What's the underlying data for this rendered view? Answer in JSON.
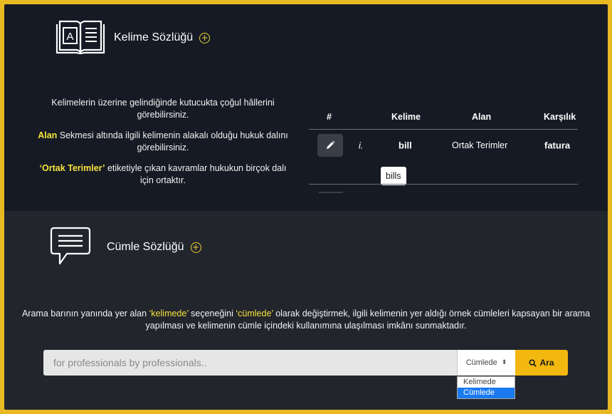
{
  "word_section": {
    "title": "Kelime Sözlüğü",
    "book_letter": "A",
    "info": {
      "p1": "Kelimelerin üzerine gelindiğinde kutucukta çoğul hâllerini görebilirsiniz.",
      "p2_highlight": "Alan",
      "p2_rest": " Sekmesi altında ilgili kelimenin alakalı olduğu hukuk dalını görebilirsiniz.",
      "p3_highlight": "‘Ortak Terimler’",
      "p3_rest": " etiketiyle çıkan kavramlar hukukun birçok dalı için ortaktır."
    },
    "table": {
      "headers": {
        "num": "#",
        "word": "Kelime",
        "field": "Alan",
        "meaning": "Karşılık"
      },
      "rows": [
        {
          "num": "i.",
          "word": "bill",
          "field": "Ortak Terimler",
          "meaning": "fatura",
          "tooltip": "bills"
        }
      ]
    }
  },
  "sentence_section": {
    "title": "Cümle Sözlüğü",
    "desc": {
      "a": "Arama barının yanında yer alan ",
      "b": "‘kelimede’",
      "c": " seçeneğini ",
      "d": "‘cümlede’",
      "e": " olarak değiştirmek, ilgili kelimenin yer aldığı örnek cümleleri kapsayan bir arama yapılması ve kelimenin cümle içindeki kullanımına ulaşılması imkânı sunmaktadır."
    },
    "search": {
      "placeholder": "for professionals by professionals..",
      "mode_selected": "Cümlede",
      "mode_options": [
        "Kelimede",
        "Cümlede"
      ],
      "button_label": "Ara"
    }
  },
  "colors": {
    "border": "#e8b923",
    "highlight": "#f5e43c",
    "button": "#f3b80f",
    "top_bg": "#161a24",
    "bottom_bg": "#23252d"
  }
}
